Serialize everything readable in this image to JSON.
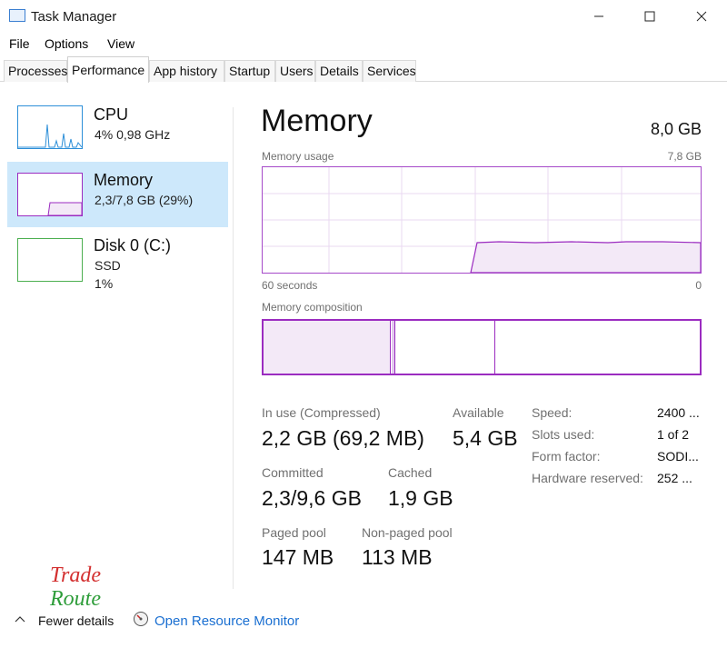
{
  "window": {
    "title": "Task Manager"
  },
  "menu": {
    "file": "File",
    "options": "Options",
    "view": "View"
  },
  "tabs": [
    "Processes",
    "Performance",
    "App history",
    "Startup",
    "Users",
    "Details",
    "Services"
  ],
  "sidebar": {
    "cpu": {
      "name": "CPU",
      "sub": "4%  0,98 GHz"
    },
    "memory": {
      "name": "Memory",
      "sub": "2,3/7,8 GB (29%)"
    },
    "disk": {
      "name": "Disk 0 (C:)",
      "type": "SSD",
      "usage": "1%"
    }
  },
  "main": {
    "title": "Memory",
    "total": "8,0 GB",
    "usage_label": "Memory usage",
    "usage_max": "7,8 GB",
    "time_left": "60 seconds",
    "time_right": "0",
    "composition_label": "Memory composition"
  },
  "stats": {
    "in_use_label": "In use (Compressed)",
    "in_use_value": "2,2 GB (69,2 MB)",
    "available_label": "Available",
    "available_value": "5,4 GB",
    "committed_label": "Committed",
    "committed_value": "2,3/9,6 GB",
    "cached_label": "Cached",
    "cached_value": "1,9 GB",
    "paged_label": "Paged pool",
    "paged_value": "147 MB",
    "nonpaged_label": "Non-paged pool",
    "nonpaged_value": "113 MB"
  },
  "details": {
    "speed_label": "Speed:",
    "speed_value": "2400 ...",
    "slots_label": "Slots used:",
    "slots_value": "1 of 2",
    "form_label": "Form factor:",
    "form_value": "SODI...",
    "hw_label": "Hardware reserved:",
    "hw_value": "252 ..."
  },
  "footer": {
    "fewer_details": "Fewer details",
    "open_resource_monitor": "Open Resource Monitor"
  },
  "watermark": {
    "line1": "Trade",
    "line2": "Route"
  },
  "colors": {
    "memory_accent": "#9b2cc0",
    "cpu_accent": "#2d8fd8",
    "disk_accent": "#4caf50",
    "selected_bg": "#cde8fb",
    "link": "#1a6fd1"
  }
}
